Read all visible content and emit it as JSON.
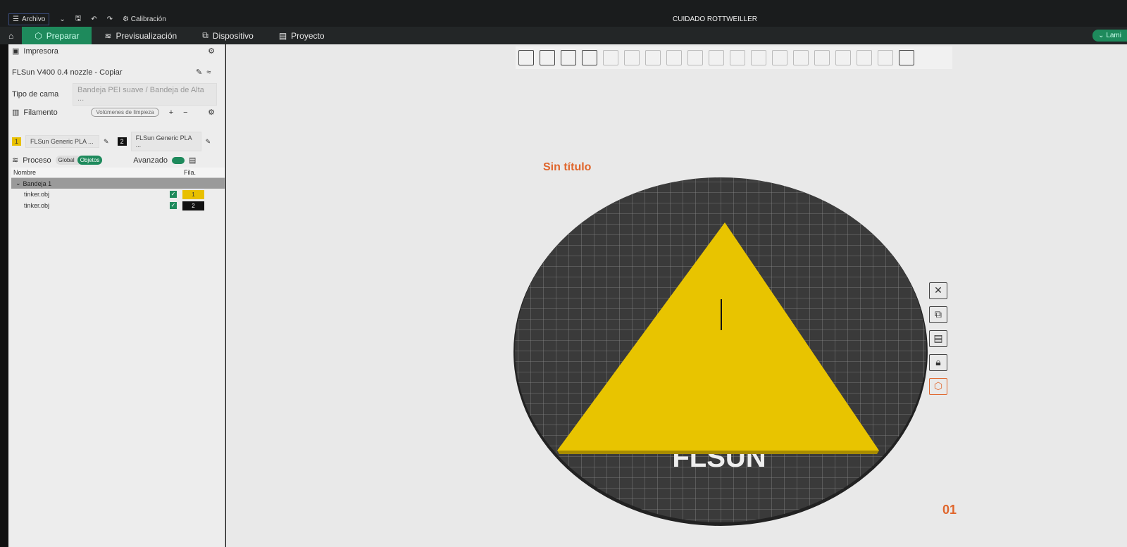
{
  "topbar": {
    "archivo": "Archivo",
    "calibracion": "Calibración",
    "window_title": "CUIDADO ROTTWEILLER"
  },
  "tabs": [
    {
      "label": "Preparar"
    },
    {
      "label": "Previsualización"
    },
    {
      "label": "Dispositivo"
    },
    {
      "label": "Proyecto"
    }
  ],
  "slice_button": "Lami",
  "sidebar": {
    "printer_section": "Impresora",
    "printer": "FLSun V400 0.4 nozzle - Copiar",
    "bed_label": "Tipo de cama",
    "bed_value": "Bandeja PEI suave / Bandeja de Alta ...",
    "filament_section": "Filamento",
    "flush_button": "Volúmenes de limpieza",
    "filaments": [
      {
        "num": "1",
        "name": "FLSun Generic PLA ...",
        "color": "#e8c000"
      },
      {
        "num": "2",
        "name": "FLSun Generic PLA ...",
        "color": "#111111"
      }
    ],
    "process_section": "Proceso",
    "global": "Global",
    "objects": "Objetos",
    "advanced": "Avanzado",
    "table": {
      "col_name": "Nombre",
      "col_fil": "Fila.",
      "group": "Bandeja 1",
      "rows": [
        {
          "name": "tinker.obj",
          "fil": "1",
          "color": "#e8c000"
        },
        {
          "name": "tinker.obj",
          "fil": "2",
          "color": "#111111"
        }
      ]
    }
  },
  "canvas": {
    "title": "Sin título",
    "plate_number": "01",
    "bed_logo": "FLSUN",
    "accent": "#e0662c",
    "model_color": "#e8c400"
  }
}
